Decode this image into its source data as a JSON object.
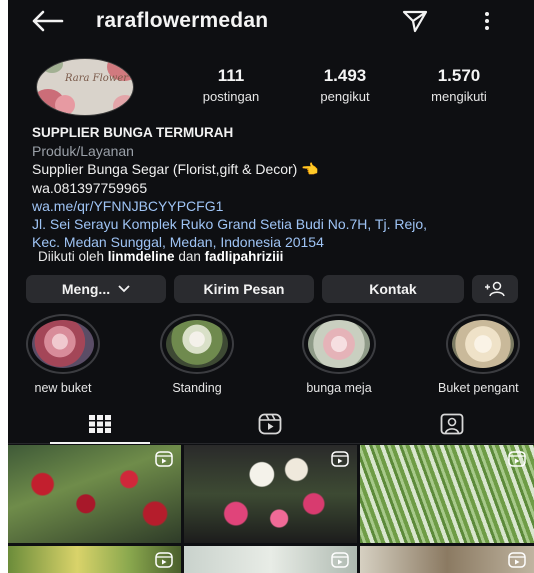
{
  "header": {
    "username": "raraflowermedan"
  },
  "profile": {
    "avatar_text": "Rara Flower",
    "stats": [
      {
        "value": "111",
        "label": "postingan"
      },
      {
        "value": "1.493",
        "label": "pengikut"
      },
      {
        "value": "1.570",
        "label": "mengikuti"
      }
    ],
    "name": "SUPPLIER BUNGA TERMURAH",
    "category": "Produk/Layanan",
    "bio_line1": "Supplier Bunga Segar (Florist,gift & Decor) 👈",
    "bio_line2": "wa.081397759965",
    "link": "wa.me/qr/YFNNJBCYYPCFG1",
    "address": "Jl. Sei Serayu Komplek Ruko Grand Setia Budi No.7H, Tj. Rejo, Kec. Medan Sunggal, Medan, Indonesia 20154",
    "followed_prefix": "Diikuti oleh",
    "followed_user1": "linmdeline",
    "followed_conj": "dan",
    "followed_user2": "fadlipahriziii"
  },
  "buttons": {
    "following": "Meng...",
    "message": "Kirim Pesan",
    "contact": "Kontak"
  },
  "highlights": [
    {
      "label": "new buket"
    },
    {
      "label": "Standing"
    },
    {
      "label": "bunga meja"
    },
    {
      "label": "Buket pengant"
    }
  ],
  "icons": {
    "back": "arrow-left-icon",
    "send": "paper-plane-icon",
    "more": "more-vertical-icon",
    "grid": "grid-icon",
    "reels": "reels-icon",
    "tagged": "tagged-icon",
    "add_person": "add-person-icon",
    "chevron": "chevron-down-icon"
  },
  "colors": {
    "background": "#0e0f12",
    "button": "#2a2b2f",
    "link": "#9fc4f5",
    "category": "#9aa0a8"
  }
}
